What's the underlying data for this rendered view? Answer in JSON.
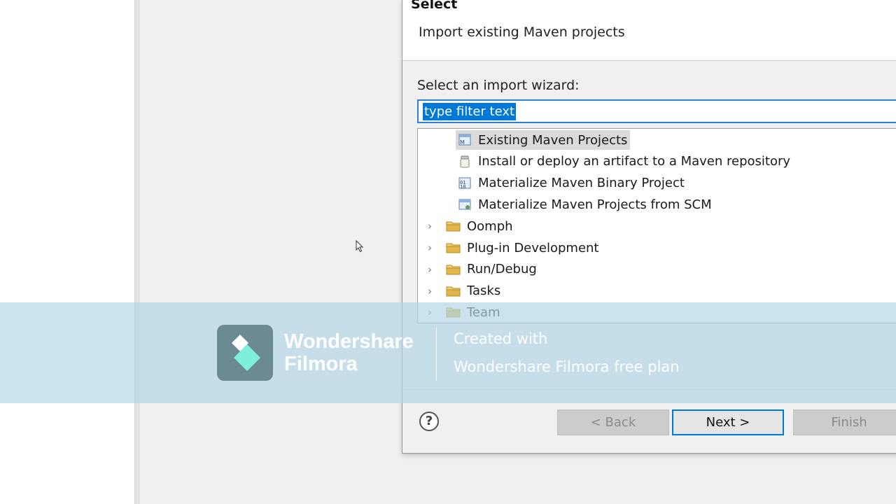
{
  "dialog": {
    "title": "Select",
    "subtitle": "Import existing Maven projects",
    "wizard_label": "Select an import wizard:",
    "filter": {
      "value": "type filter text"
    },
    "tree": [
      {
        "label": "Existing Maven Projects",
        "icon": "maven-project-icon",
        "level": 1,
        "selected": true
      },
      {
        "label": "Install or deploy an artifact to a Maven repository",
        "icon": "jar-icon",
        "level": 1
      },
      {
        "label": "Materialize Maven Binary Project",
        "icon": "maven-binary-icon",
        "level": 1
      },
      {
        "label": "Materialize Maven Projects from SCM",
        "icon": "maven-scm-icon",
        "level": 1
      },
      {
        "label": "Oomph",
        "icon": "folder-icon",
        "level": 0,
        "expandable": true
      },
      {
        "label": "Plug-in Development",
        "icon": "folder-icon",
        "level": 0,
        "expandable": true
      },
      {
        "label": "Run/Debug",
        "icon": "folder-icon",
        "level": 0,
        "expandable": true
      },
      {
        "label": "Tasks",
        "icon": "folder-icon",
        "level": 0,
        "expandable": true
      },
      {
        "label": "Team",
        "icon": "folder-icon",
        "level": 0,
        "expandable": true
      }
    ],
    "buttons": {
      "help": "?",
      "back": "< Back",
      "next": "Next >",
      "finish": "Finish"
    }
  },
  "watermark": {
    "brand_line1": "Wondershare",
    "brand_line2": "Filmora",
    "created_with": "Created with",
    "plan": "Wondershare Filmora free plan"
  },
  "colors": {
    "selection": "#0078d7",
    "folder": "#e3b64d",
    "watermark_band": "#b2d5e6"
  }
}
